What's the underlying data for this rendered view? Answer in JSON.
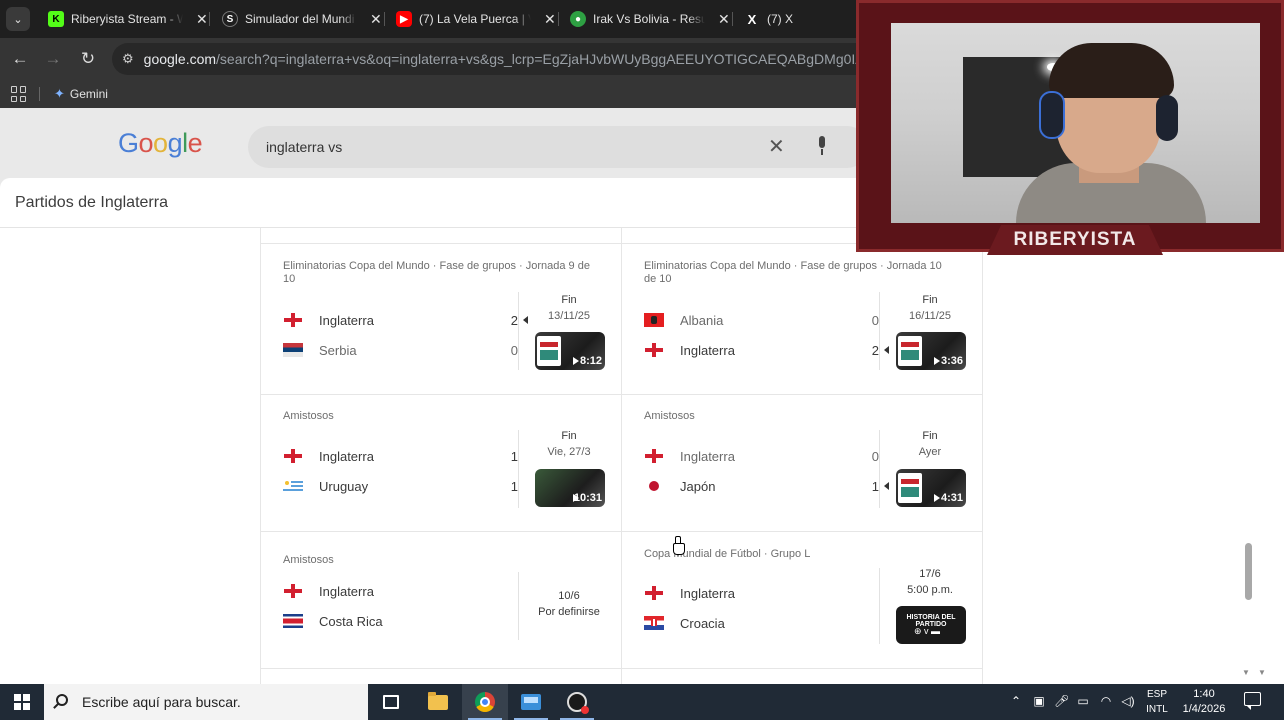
{
  "browser": {
    "tabs": [
      {
        "title": "Riberyista Stream - W",
        "favicon": "kick-icon",
        "color": "#53fc18"
      },
      {
        "title": "Simulador del Mundi",
        "favicon": "globe-icon",
        "color": "#1f1f1f"
      },
      {
        "title": "(7) La Vela Puerca | Vi",
        "favicon": "youtube-icon",
        "color": "#ff0000"
      },
      {
        "title": "Irak Vs Bolivia - Resul",
        "favicon": "soccer-ball-icon",
        "color": "#2ea043"
      },
      {
        "title": "(7) X",
        "favicon": "x-icon",
        "color": "#1f1f1f"
      }
    ],
    "url_domain": "google.com",
    "url_path": "/search?q=inglaterra+vs&oq=inglaterra+vs&gs_lcrp=EgZjaHJvbWUyBggAEEUYOTIGCAEQABgDMg0IAhAAGIM",
    "bookmark_gemini": "Gemini"
  },
  "google": {
    "logo_letters": [
      "G",
      "o",
      "o",
      "g",
      "l",
      "e"
    ],
    "query": "inglaterra vs"
  },
  "sheet": {
    "title": "Partidos de Inglaterra",
    "matches": [
      {
        "league": "Eliminatorias Copa del Mundo · Fase de grupos · Jornada 9 de 10",
        "teams": [
          {
            "name": "Inglaterra",
            "flag": "flag-england-icon",
            "score": "2",
            "winner": true
          },
          {
            "name": "Serbia",
            "flag": "flag-serbia-icon",
            "score": "0",
            "winner": false
          }
        ],
        "status": "Fin",
        "date": "13/11/25",
        "video_duration": "8:12"
      },
      {
        "league": "Eliminatorias Copa del Mundo · Fase de grupos · Jornada 10 de 10",
        "teams": [
          {
            "name": "Albania",
            "flag": "flag-albania-icon",
            "score": "0",
            "winner": false
          },
          {
            "name": "Inglaterra",
            "flag": "flag-england-icon",
            "score": "2",
            "winner": true
          }
        ],
        "status": "Fin",
        "date": "16/11/25",
        "video_duration": "3:36"
      },
      {
        "league": "Amistosos",
        "teams": [
          {
            "name": "Inglaterra",
            "flag": "flag-england-icon",
            "score": "1",
            "winner": false
          },
          {
            "name": "Uruguay",
            "flag": "flag-uruguay-icon",
            "score": "1",
            "winner": false
          }
        ],
        "status": "Fin",
        "date": "Vie, 27/3",
        "video_duration": "10:31"
      },
      {
        "league": "Amistosos",
        "teams": [
          {
            "name": "Inglaterra",
            "flag": "flag-england-icon",
            "score": "0",
            "winner": false
          },
          {
            "name": "Japón",
            "flag": "flag-japan-icon",
            "score": "1",
            "winner": true
          }
        ],
        "status": "Fin",
        "date": "Ayer",
        "video_duration": "4:31"
      },
      {
        "league": "Amistosos",
        "teams": [
          {
            "name": "Inglaterra",
            "flag": "flag-england-icon",
            "score": "",
            "winner": false
          },
          {
            "name": "Costa Rica",
            "flag": "flag-costa-rica-icon",
            "score": "",
            "winner": false
          }
        ],
        "status": "10/6",
        "date": "Por definirse",
        "video_duration": ""
      },
      {
        "league": "Copa Mundial de Fútbol · Grupo L",
        "teams": [
          {
            "name": "Inglaterra",
            "flag": "flag-england-icon",
            "score": "",
            "winner": false
          },
          {
            "name": "Croacia",
            "flag": "flag-croatia-icon",
            "score": "",
            "winner": false
          }
        ],
        "status": "17/6",
        "date": "5:00 p.m.",
        "preview_text": "HISTORIA DEL PARTIDO",
        "video_duration": ""
      }
    ]
  },
  "webcam": {
    "nameplate": "RIBERYISTA",
    "frame_color": "#5a1318"
  },
  "taskbar": {
    "search_placeholder": "Escribe aquí para buscar.",
    "language_top": "ESP",
    "language_bottom": "INTL",
    "time": "1:40",
    "date": "1/4/2026"
  }
}
